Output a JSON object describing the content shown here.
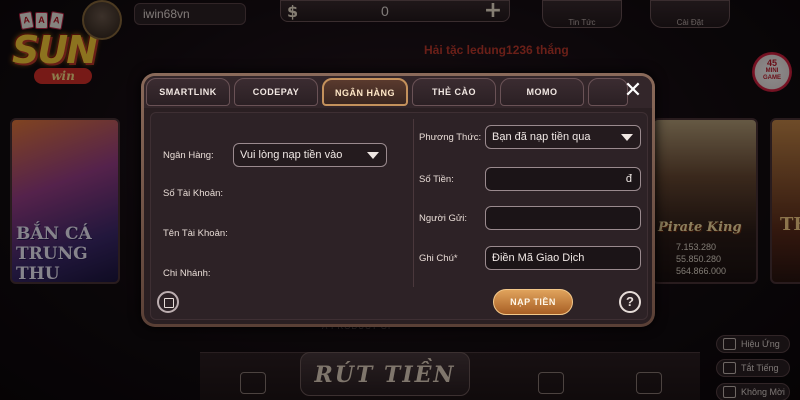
{
  "logo": {
    "brand": "SUN",
    "sub": "win",
    "cards": [
      "A",
      "A",
      "A"
    ]
  },
  "header": {
    "username": "iwin68vn",
    "currency_symbol": "$",
    "balance": "0",
    "add_symbol": "+",
    "news_label": "Tin Tức",
    "settings_label": "Cài Đặt",
    "ticker": "Hải tặc ledung1236 thắng"
  },
  "minigame": {
    "count": "45",
    "label_line1": "MINI",
    "label_line2": "GAME"
  },
  "games": {
    "left_title_1": "BẮN CÁ",
    "left_title_2": "TRUNG THU",
    "pirate_title": "Pirate King",
    "pirate_stats": [
      "7.153.280",
      "55.850.280",
      "564.866.000"
    ],
    "right_title": "TH"
  },
  "product_text": "A PRODUCT OF",
  "withdraw_label": "RÚT TIỀN",
  "side": {
    "effects": "Hiệu Ứng",
    "mute": "Tắt Tiếng",
    "nofx": "Không Mời"
  },
  "dialog": {
    "tabs": [
      "SMARTLINK",
      "CODEPAY",
      "NGÂN HÀNG",
      "THẺ CÀO",
      "MOMO"
    ],
    "active_tab": "NGÂN HÀNG",
    "close_symbol": "✕",
    "left": {
      "bank_label": "Ngân Hàng:",
      "bank_value": "Vui lòng nạp tiền vào",
      "account_no_label": "Số Tài Khoản:",
      "account_name_label": "Tên Tài Khoản:",
      "branch_label": "Chi Nhánh:"
    },
    "right": {
      "method_label": "Phương Thức:",
      "method_value": "Bạn đã nạp tiền qua",
      "amount_label": "Số Tiền:",
      "amount_unit": "đ",
      "sender_label": "Người Gửi:",
      "note_label": "Ghi Chú*",
      "note_value": "Điền Mã Giao Dịch"
    },
    "submit_label": "NẠP TIỀN",
    "help_symbol": "?"
  }
}
